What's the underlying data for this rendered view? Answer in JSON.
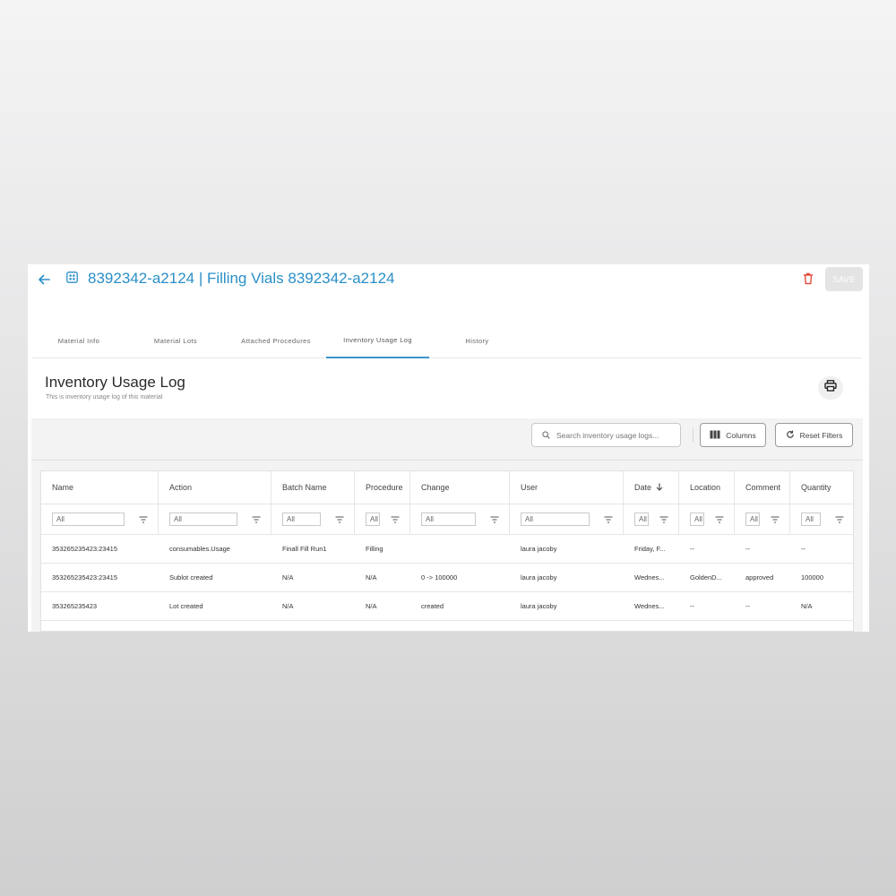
{
  "header": {
    "title": "8392342-a2124 | Filling Vials 8392342-a2124",
    "save_label": "SAVE",
    "accent": "#2a8fc7",
    "delete_color": "#e74c3c"
  },
  "tabs": [
    {
      "label": "Material Info"
    },
    {
      "label": "Material Lots"
    },
    {
      "label": "Attached Procedures"
    },
    {
      "label": "Inventory Usage Log",
      "active": true
    },
    {
      "label": "History"
    }
  ],
  "section": {
    "title": "Inventory Usage Log",
    "subtitle": "This is inventory usage log of this material"
  },
  "toolbar": {
    "search_placeholder": "Search inventory usage logs...",
    "columns_label": "Columns",
    "reset_label": "Reset Filters"
  },
  "table": {
    "columns": [
      {
        "label": "Name",
        "filter": "All"
      },
      {
        "label": "Action",
        "filter": "All"
      },
      {
        "label": "Batch Name",
        "filter": "All"
      },
      {
        "label": "Procedure Title",
        "filter": "All"
      },
      {
        "label": "Change",
        "filter": "All"
      },
      {
        "label": "User",
        "filter": "All"
      },
      {
        "label": "Date",
        "filter": "All"
      },
      {
        "label": "Location",
        "filter": "All"
      },
      {
        "label": "Comment",
        "filter": "All"
      },
      {
        "label": "Quantity",
        "filter": "All"
      }
    ],
    "rows": [
      [
        "353265235423:23415",
        "consumables.Usage",
        "Finall Fill Run1",
        "Filling",
        "",
        "laura jacoby",
        "Friday, F...",
        "--",
        "--",
        "--"
      ],
      [
        "353265235423:23415",
        "Sublot created",
        "N/A",
        "N/A",
        "0 -> 100000",
        "laura jacoby",
        "Wednes...",
        "GoldenD...",
        "approved",
        "100000"
      ],
      [
        "353265235423",
        "Lot created",
        "N/A",
        "N/A",
        "created",
        "laura jacoby",
        "Wednes...",
        "--",
        "--",
        "N/A"
      ]
    ]
  }
}
